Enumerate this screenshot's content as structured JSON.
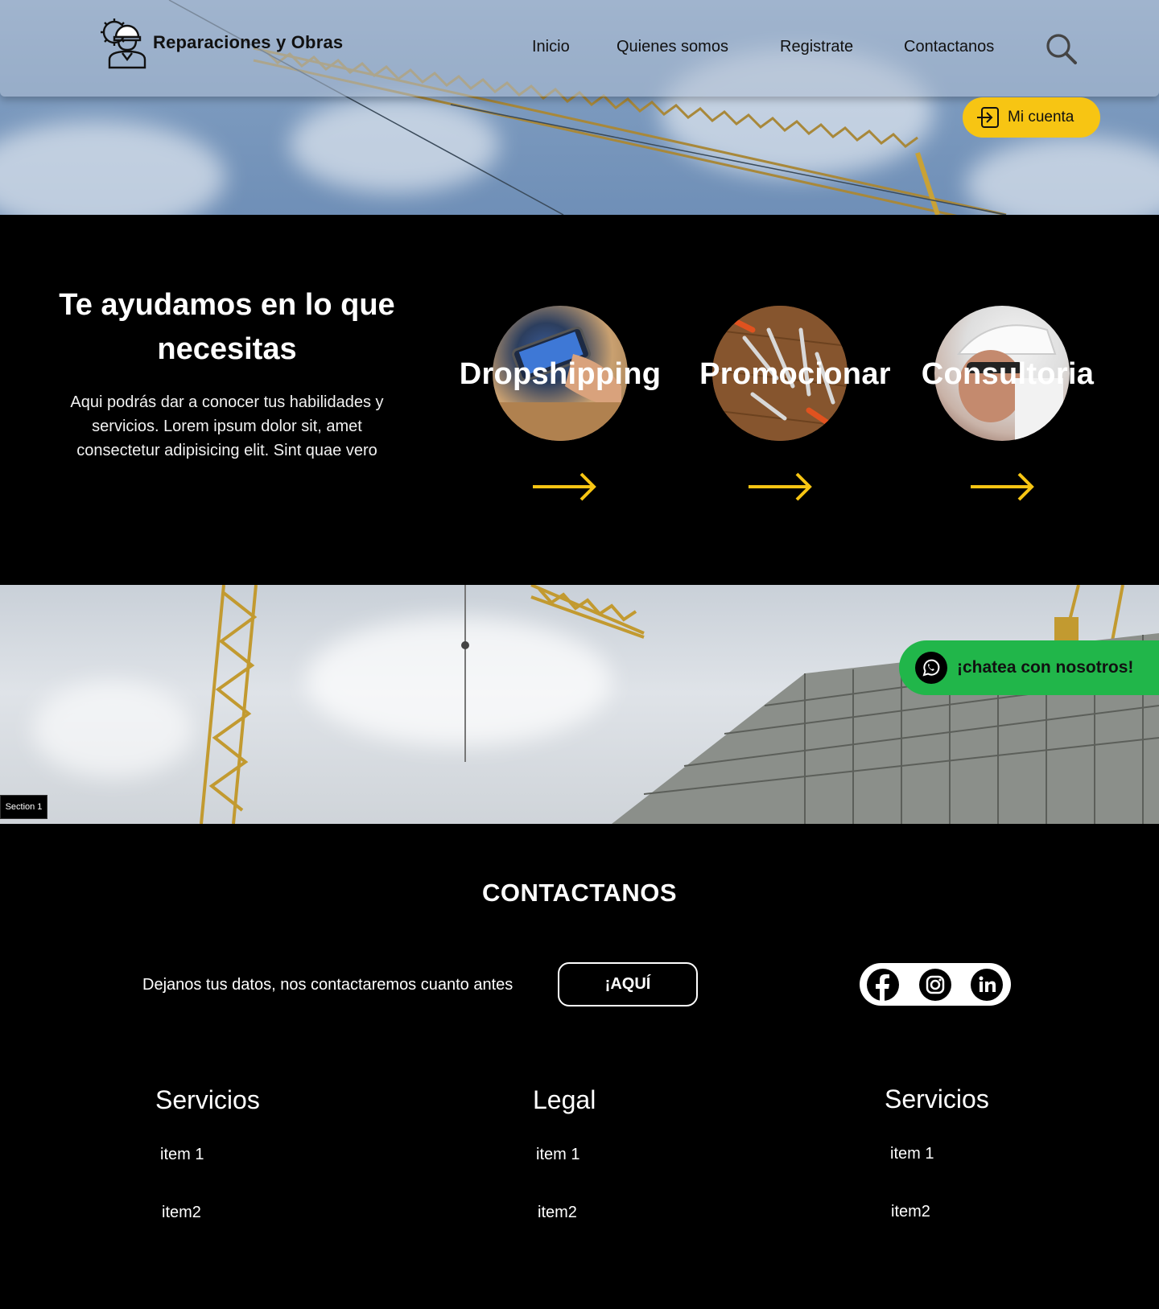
{
  "header": {
    "brand_name": "Reparaciones y Obras",
    "nav": [
      "Inicio",
      "Quienes somos",
      "Registrate",
      "Contactanos"
    ],
    "account_label": "Mi cuenta"
  },
  "services": {
    "title": "Te ayudamos en lo que necesitas",
    "description": "Aqui podrás dar a conocer tus habilidades y servicios. Lorem ipsum dolor sit, amet consectetur adipisicing elit. Sint quae vero",
    "items": [
      {
        "label": "Dropshipping"
      },
      {
        "label": "Promocionar"
      },
      {
        "label": "Consultoria"
      }
    ]
  },
  "banner": {
    "chat_label": "¡chatea con nosotros!",
    "section_label": "Section 1"
  },
  "contact": {
    "title": "CONTACTANOS",
    "text": "Dejanos tus datos, nos contactaremos cuanto antes",
    "button_label": "¡AQUÍ"
  },
  "footer": {
    "columns": [
      {
        "title": "Servicios",
        "items": [
          "item 1",
          "item2"
        ]
      },
      {
        "title": "Legal",
        "items": [
          "item 1",
          "item2"
        ]
      },
      {
        "title": "Servicios",
        "items": [
          "item 1",
          "item2"
        ]
      }
    ]
  },
  "colors": {
    "accent": "#f7c513",
    "whatsapp": "#21b64a",
    "background": "#000000"
  }
}
